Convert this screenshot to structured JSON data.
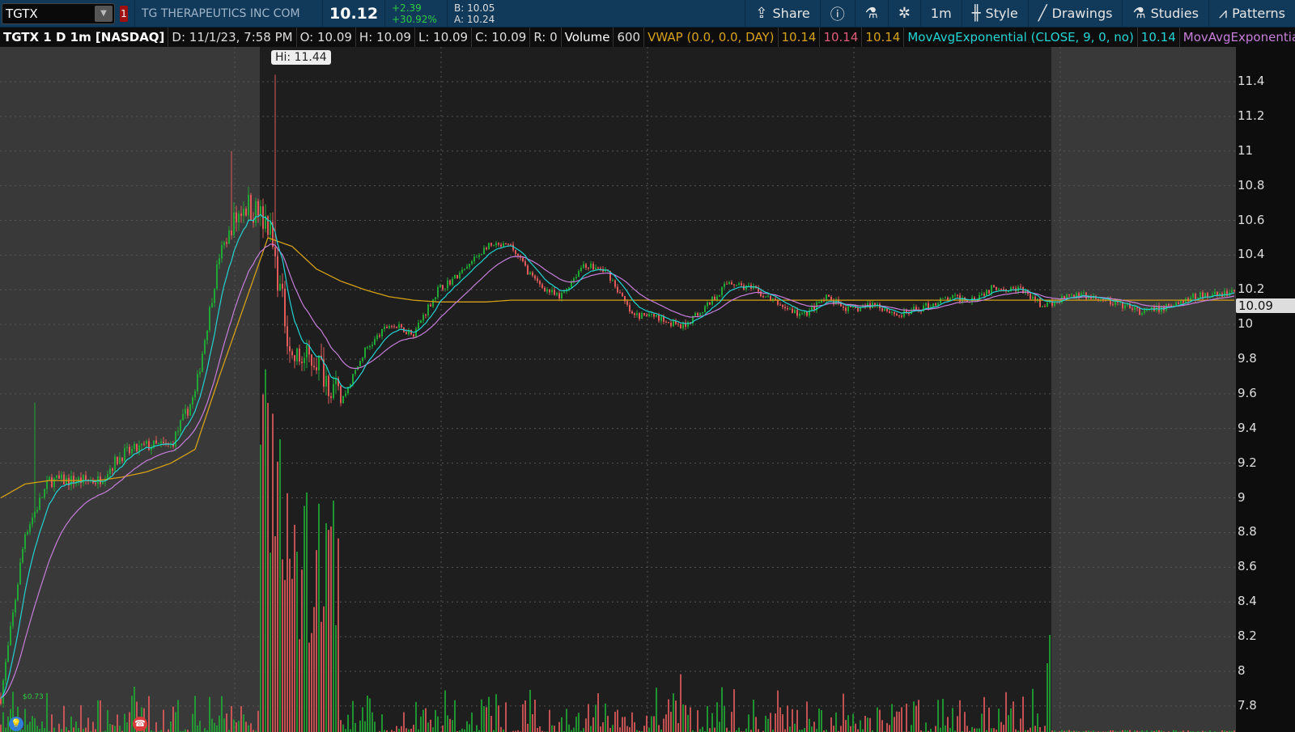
{
  "header": {
    "symbol": "TGTX",
    "link_num": "1",
    "company": "TG THERAPEUTICS INC COM",
    "last": "10.12",
    "change": "+2.39",
    "change_pct": "+30.92%",
    "bid": "B: 10.05",
    "ask": "A: 10.24"
  },
  "toolbar": [
    {
      "label": "Share",
      "icon": "share-icon"
    },
    {
      "label": "",
      "icon": "info-icon"
    },
    {
      "label": "",
      "icon": "flask-icon"
    },
    {
      "label": "",
      "icon": "gear-icon"
    },
    {
      "label": "1m",
      "icon": ""
    },
    {
      "label": "Style",
      "icon": "candle-icon"
    },
    {
      "label": "Drawings",
      "icon": "pencil-line-icon"
    },
    {
      "label": "Studies",
      "icon": "flask-icon"
    },
    {
      "label": "Patterns",
      "icon": "pattern-icon"
    }
  ],
  "info": {
    "title": "TGTX 1 D 1m [NASDAQ]",
    "date": "D: 11/1/23, 7:58 PM",
    "open": "O: 10.09",
    "high": "H: 10.09",
    "low": "L: 10.09",
    "close": "C: 10.09",
    "range": "R: 0",
    "vol_label": "Volume",
    "vol": "600",
    "vwap": "VWAP (0.0, 0.0, DAY)",
    "vwap1": "10.14",
    "vwap2": "10.14",
    "vwap3": "10.14",
    "ema9": "MovAvgExponential (CLOSE, 9, 0, no)",
    "ema9v": "10.14",
    "ema2": "MovAvgExponential ..."
  },
  "colors": {
    "up": "#1fa834",
    "down": "#e05a5a",
    "vwap": "#d4a017",
    "ema9": "#22d3d3",
    "ema2": "#c77ddb"
  },
  "chart": {
    "hi_label": "Hi: 11.44",
    "current_price": "10.09",
    "earnings_label": "$0.73",
    "y_ticks": [
      "11.4",
      "11.2",
      "11",
      "10.8",
      "10.6",
      "10.4",
      "10.2",
      "10",
      "9.8",
      "9.6",
      "9.4",
      "9.2",
      "9",
      "8.8",
      "8.6",
      "8.4",
      "8.2",
      "8",
      "7.8"
    ],
    "price_path_every_10_bars": [
      7.85,
      8.8,
      9.1,
      9.1,
      9.1,
      9.25,
      9.3,
      9.3,
      9.6,
      10.4,
      10.7,
      10.6,
      9.8,
      9.8,
      9.55,
      9.85,
      10.0,
      9.95,
      10.2,
      10.3,
      10.45,
      10.45,
      10.25,
      10.15,
      10.35,
      10.3,
      10.05,
      10.05,
      9.98,
      10.1,
      10.25,
      10.2,
      10.12,
      10.05,
      10.15,
      10.08,
      10.12,
      10.05,
      10.1,
      10.15,
      10.15,
      10.22,
      10.2,
      10.1,
      10.18,
      10.15,
      10.12,
      10.07,
      10.1,
      10.16,
      10.17,
      10.2
    ],
    "vwap_path_every_10_bars": [
      9.0,
      9.08,
      9.1,
      9.1,
      9.1,
      9.12,
      9.15,
      9.2,
      9.28,
      9.7,
      10.1,
      10.5,
      10.45,
      10.32,
      10.25,
      10.2,
      10.16,
      10.14,
      10.13,
      10.13,
      10.13,
      10.14,
      10.14,
      10.14,
      10.14,
      10.14,
      10.14,
      10.14,
      10.14,
      10.14,
      10.14,
      10.14,
      10.14,
      10.14,
      10.14,
      10.14,
      10.14,
      10.14,
      10.14,
      10.14,
      10.14,
      10.14,
      10.14,
      10.14,
      10.14,
      10.14,
      10.14,
      10.14,
      10.14,
      10.14,
      10.14,
      10.14
    ],
    "high_spikes": [
      {
        "bar": 95,
        "high": 11.0
      },
      {
        "bar": 113,
        "high": 11.44
      },
      {
        "bar": 14,
        "high": 9.55
      }
    ],
    "sessions": {
      "premarket_end_bar": 107,
      "afterhours_start_bar": 433
    }
  }
}
